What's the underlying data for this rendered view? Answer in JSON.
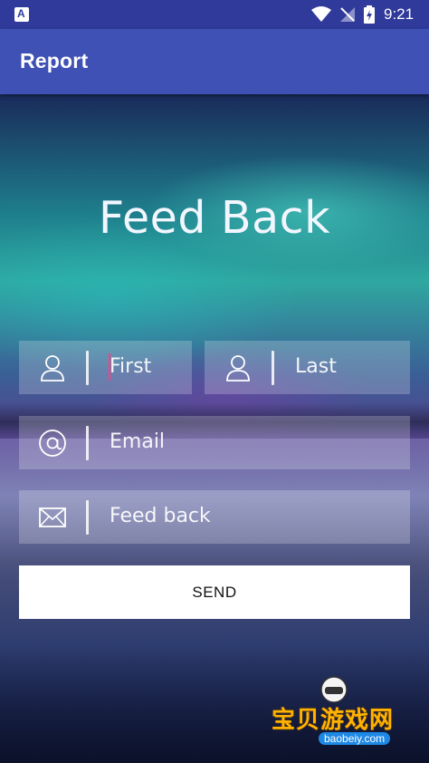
{
  "status_bar": {
    "time": "9:21",
    "left_icon": "app-notification-icon",
    "icons": [
      "wifi-icon",
      "no-signal-icon",
      "battery-charging-icon"
    ]
  },
  "app_bar": {
    "title": "Report"
  },
  "form": {
    "headline": "Feed Back",
    "first_name": {
      "placeholder": "First",
      "icon": "person-icon"
    },
    "last_name": {
      "placeholder": "Last",
      "icon": "person-icon"
    },
    "email": {
      "placeholder": "Email",
      "icon": "at-icon"
    },
    "feedback": {
      "placeholder": "Feed back",
      "icon": "envelope-icon"
    },
    "send_label": "SEND"
  },
  "watermark": {
    "text": "宝贝游戏网",
    "domain": "baobeiy.com"
  },
  "colors": {
    "status_bar": "#2f3a9b",
    "app_bar": "#3f51b5",
    "caret": "#ff3d7f",
    "send_bg": "#ffffff"
  }
}
